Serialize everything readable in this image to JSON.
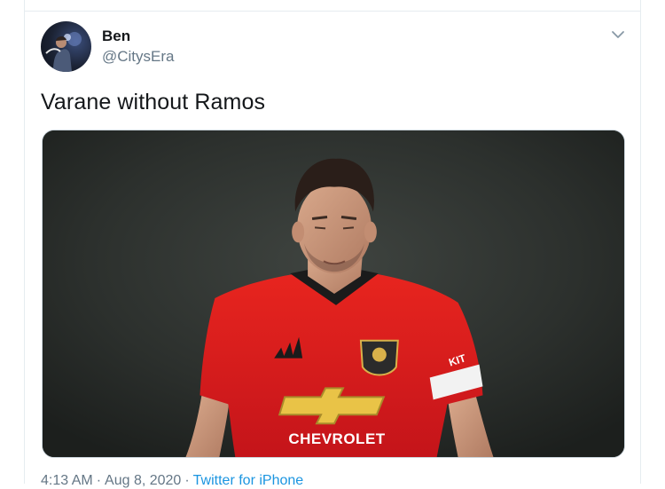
{
  "tweet": {
    "author_name": "Ben",
    "author_handle": "@CitysEra",
    "text": "Varane without Ramos",
    "timestamp": "4:13 AM",
    "date": "Aug 8, 2020",
    "source": "Twitter for iPhone",
    "separator": "·",
    "menu_icon": "chevron-down-icon"
  },
  "photo": {
    "jersey_sponsor": "CHEVROLET",
    "kit_brand_tag": "KIT"
  },
  "colors": {
    "text_primary": "#14171a",
    "text_secondary": "#657786",
    "link": "#1b95e0",
    "border": "#e6ecf0",
    "jersey_red": "#e0201e"
  }
}
